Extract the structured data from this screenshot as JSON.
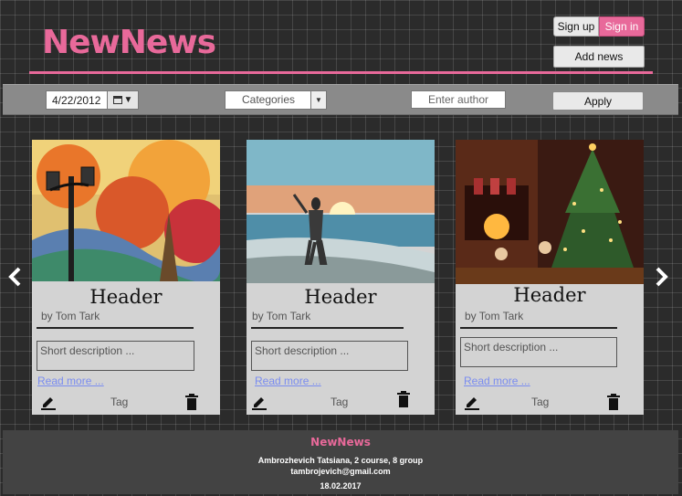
{
  "header": {
    "logo": "NewNews",
    "signup_label": "Sign up",
    "signin_label": "Sign in",
    "addnews_label": "Add news"
  },
  "filters": {
    "date_value": "4/22/2012",
    "category_label": "Categories",
    "author_placeholder": "Enter author",
    "apply_label": "Apply"
  },
  "cards": [
    {
      "title": "Header",
      "byline": "by Tom Tark",
      "description_placeholder": "Short description ...",
      "readmore": "Read more ...",
      "tag": "Tag"
    },
    {
      "title": "Header",
      "byline": "by Tom Tark",
      "description_placeholder": "Short description ...",
      "readmore": "Read more ...",
      "tag": "Tag"
    },
    {
      "title": "Header",
      "byline": "by Tom Tark",
      "description_placeholder": "Short description ...",
      "readmore": "Read more ...",
      "tag": "Tag"
    }
  ],
  "footer": {
    "logo": "NewNews",
    "author": "Ambrozhevich Tatsiana, 2 course, 8  group",
    "email": "tambrojevich@gmail.com",
    "date": "18.02.2017"
  },
  "colors": {
    "accent": "#e8699a",
    "link": "#7a8cf0",
    "card_bg": "#d3d3d3",
    "filter_bg": "#8a8a8a",
    "footer_bg": "#434343"
  },
  "icons": [
    "calendar-icon",
    "chevron-down-icon",
    "chevron-left-icon",
    "chevron-right-icon",
    "pencil-icon",
    "trash-icon"
  ]
}
